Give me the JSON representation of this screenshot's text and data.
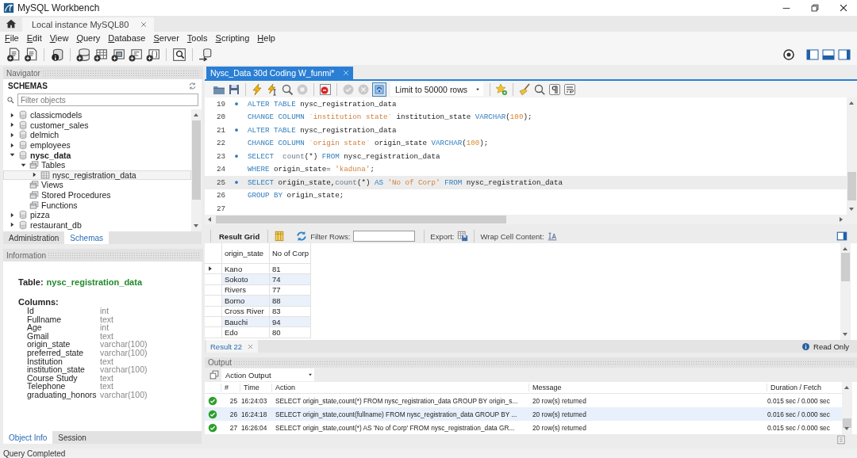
{
  "window": {
    "title": "MySQL Workbench"
  },
  "connection_tabs": [
    {
      "label": "Local instance MySQL80",
      "selected": true
    }
  ],
  "menu": [
    "File",
    "Edit",
    "View",
    "Query",
    "Database",
    "Server",
    "Tools",
    "Scripting",
    "Help"
  ],
  "navigator": {
    "title": "Navigator",
    "section": "SCHEMAS",
    "filter": {
      "placeholder": "Filter objects"
    },
    "schemas": [
      {
        "label": "classicmodels",
        "kind": "schema",
        "expanded": false,
        "default": false,
        "selected": false
      },
      {
        "label": "customer_sales",
        "kind": "schema",
        "expanded": false,
        "default": false,
        "selected": false
      },
      {
        "label": "delmich",
        "kind": "schema",
        "expanded": false,
        "default": false,
        "selected": false
      },
      {
        "label": "employees",
        "kind": "schema",
        "expanded": false,
        "default": false,
        "selected": false
      },
      {
        "label": "nysc_data",
        "kind": "schema",
        "expanded": true,
        "default": true,
        "selected": false,
        "children": [
          {
            "label": "Tables",
            "kind": "folder",
            "expanded": true,
            "default": false,
            "selected": false,
            "children": [
              {
                "label": "nysc_registration_data",
                "kind": "table",
                "expanded": false,
                "default": false,
                "selected": true
              }
            ]
          },
          {
            "label": "Views",
            "kind": "folder",
            "default": false,
            "selected": false
          },
          {
            "label": "Stored Procedures",
            "kind": "folder",
            "default": false,
            "selected": false
          },
          {
            "label": "Functions",
            "kind": "folder",
            "default": false,
            "selected": false
          }
        ]
      },
      {
        "label": "pizza",
        "kind": "schema",
        "expanded": false,
        "default": false,
        "selected": false
      },
      {
        "label": "restaurant_db",
        "kind": "schema",
        "expanded": false,
        "default": false,
        "selected": false
      }
    ],
    "tabs": [
      {
        "label": "Administration",
        "selected": false
      },
      {
        "label": "Schemas",
        "selected": true
      }
    ]
  },
  "information": {
    "title": "Information",
    "table_label": "Table:",
    "table_name": "nysc_registration_data",
    "columns_label": "Columns:",
    "columns": [
      {
        "name": "Id",
        "type": "int"
      },
      {
        "name": "Fullname",
        "type": "text"
      },
      {
        "name": "Age",
        "type": "int"
      },
      {
        "name": "Gmail",
        "type": "text"
      },
      {
        "name": "origin_state",
        "type": "varchar(100)"
      },
      {
        "name": "preferred_state",
        "type": "varchar(100)"
      },
      {
        "name": "Institution",
        "type": "text"
      },
      {
        "name": "institution_state",
        "type": "varchar(100)"
      },
      {
        "name": "Course Study",
        "type": "text"
      },
      {
        "name": "Telephone",
        "type": "text"
      },
      {
        "name": "graduating_honors",
        "type": "varchar(100)"
      }
    ],
    "tabs": [
      {
        "label": "Object Info",
        "selected": true
      },
      {
        "label": "Session",
        "selected": false
      }
    ]
  },
  "editor": {
    "tab": {
      "label": "Nysc_Data 30d Coding W_funmi*"
    },
    "toggle_button": {
      "on": true
    },
    "limit": "Limit to 50000 rows",
    "lines": [
      {
        "number": "19",
        "marker": true,
        "current": false,
        "tokens": [
          {
            "kind": "keyword",
            "text": "ALTER TABLE"
          },
          {
            "kind": "plain",
            "text": " nysc_registration_data"
          }
        ]
      },
      {
        "number": "20",
        "marker": false,
        "current": false,
        "tokens": [
          {
            "kind": "keyword",
            "text": "CHANGE COLUMN"
          },
          {
            "kind": "string",
            "text": " `institution state`"
          },
          {
            "kind": "plain",
            "text": " institution_state "
          },
          {
            "kind": "keyword",
            "text": "VARCHAR"
          },
          {
            "kind": "plain",
            "text": "("
          },
          {
            "kind": "number",
            "text": "100"
          },
          {
            "kind": "plain",
            "text": ");"
          }
        ]
      },
      {
        "number": "21",
        "marker": true,
        "current": false,
        "tokens": [
          {
            "kind": "keyword",
            "text": "ALTER TABLE"
          },
          {
            "kind": "plain",
            "text": " nysc_registration_data"
          }
        ]
      },
      {
        "number": "22",
        "marker": false,
        "current": false,
        "tokens": [
          {
            "kind": "keyword",
            "text": "CHANGE COLUMN"
          },
          {
            "kind": "string",
            "text": " `origin state`"
          },
          {
            "kind": "plain",
            "text": " origin_state "
          },
          {
            "kind": "keyword",
            "text": "VARCHAR"
          },
          {
            "kind": "plain",
            "text": "("
          },
          {
            "kind": "number",
            "text": "100"
          },
          {
            "kind": "plain",
            "text": ");"
          }
        ]
      },
      {
        "number": "23",
        "marker": true,
        "current": false,
        "tokens": [
          {
            "kind": "keyword",
            "text": "SELECT"
          },
          {
            "kind": "function",
            "text": "  count"
          },
          {
            "kind": "plain",
            "text": "(*) "
          },
          {
            "kind": "keyword",
            "text": "FROM"
          },
          {
            "kind": "plain",
            "text": " nysc_registration_data"
          }
        ]
      },
      {
        "number": "24",
        "marker": false,
        "current": false,
        "tokens": [
          {
            "kind": "keyword",
            "text": "WHERE"
          },
          {
            "kind": "plain",
            "text": " origin_state= "
          },
          {
            "kind": "string",
            "text": "'kaduna'"
          },
          {
            "kind": "plain",
            "text": ";"
          }
        ]
      },
      {
        "number": "25",
        "marker": true,
        "current": true,
        "tokens": [
          {
            "kind": "keyword",
            "text": "SELECT"
          },
          {
            "kind": "plain",
            "text": " origin_state,"
          },
          {
            "kind": "function",
            "text": "count"
          },
          {
            "kind": "plain",
            "text": "(*) "
          },
          {
            "kind": "keyword",
            "text": "AS"
          },
          {
            "kind": "string",
            "text": " 'No of Corp' "
          },
          {
            "kind": "keyword",
            "text": "FROM"
          },
          {
            "kind": "plain",
            "text": " nysc_registration_data"
          }
        ]
      },
      {
        "number": "26",
        "marker": false,
        "current": false,
        "tokens": [
          {
            "kind": "keyword",
            "text": "GROUP BY"
          },
          {
            "kind": "plain",
            "text": " origin_state;"
          }
        ]
      },
      {
        "number": "27",
        "marker": false,
        "current": false
      }
    ]
  },
  "results": {
    "title": "Result Grid",
    "filter_label": "Filter Rows:",
    "export_label": "Export:",
    "wrap_label": "Wrap Cell Content:",
    "columns": [
      "origin_state",
      "No of Corp"
    ],
    "rows": [
      {
        "cells": [
          "Kano",
          "81"
        ],
        "selected": true
      },
      {
        "cells": [
          "Sokoto",
          "74"
        ],
        "selected": false
      },
      {
        "cells": [
          "Rivers",
          "77"
        ],
        "selected": false
      },
      {
        "cells": [
          "Borno",
          "88"
        ],
        "selected": false
      },
      {
        "cells": [
          "Cross River",
          "83"
        ],
        "selected": false
      },
      {
        "cells": [
          "Bauchi",
          "94"
        ],
        "selected": false
      },
      {
        "cells": [
          "Edo",
          "80"
        ],
        "selected": false
      }
    ],
    "tabs": [
      {
        "label": "Result 22",
        "selected": true
      }
    ],
    "read_only": "Read Only"
  },
  "output": {
    "title": "Output",
    "mode": "Action Output",
    "columns": [
      "#",
      "Time",
      "Action",
      "Message",
      "Duration / Fetch"
    ],
    "rows": [
      {
        "success": true,
        "number": "25",
        "time": "16:24:03",
        "action": "SELECT origin_state,count(*) FROM nysc_registration_data GROUP BY origin_s...",
        "message": "20 row(s) returned",
        "duration": "0.015 sec / 0.000 sec",
        "selected": false
      },
      {
        "success": true,
        "number": "26",
        "time": "16:24:18",
        "action": "SELECT origin_state,count(fullname) FROM nysc_registration_data GROUP BY ...",
        "message": "20 row(s) returned",
        "duration": "0.016 sec / 0.000 sec",
        "selected": true
      },
      {
        "success": true,
        "number": "27",
        "time": "16:26:04",
        "action": "SELECT origin_state,count(*) AS 'No of Corp' FROM nysc_registration_data GR...",
        "message": "20 row(s) returned",
        "duration": "0.015 sec / 0.000 sec",
        "selected": false
      }
    ]
  },
  "status_bar": "Query Completed"
}
